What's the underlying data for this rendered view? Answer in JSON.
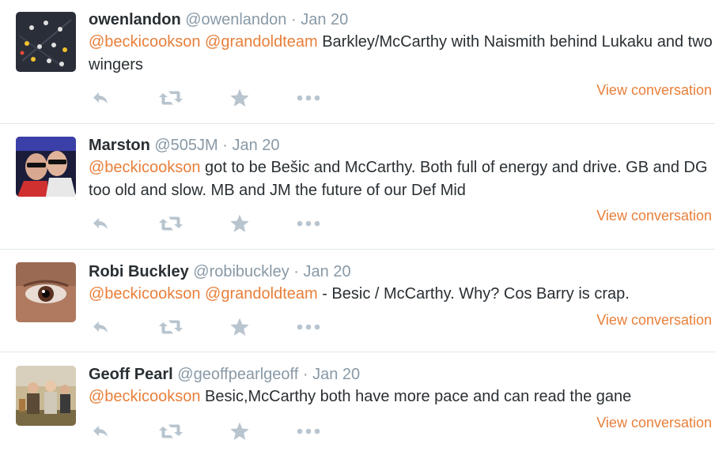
{
  "colors": {
    "accent": "#e87f3a",
    "muted": "#8899a6",
    "icon": "#b8c4ce",
    "text": "#292f33",
    "divider": "#e1e8ed"
  },
  "tweets": [
    {
      "name": "owenlandon",
      "handle": "@owenlandon",
      "separator": "·",
      "time": "Jan 20",
      "mentions": [
        "@beckicookson",
        "@grandoldteam"
      ],
      "text": " Barkley/McCarthy with Naismith behind Lukaku and two wingers",
      "view_conversation": "View conversation"
    },
    {
      "name": "Marston",
      "handle": "@505JM",
      "separator": "·",
      "time": "Jan 20",
      "mentions": [
        "@beckicookson"
      ],
      "text": " got to be Bešic and McCarthy. Both full of energy and drive. GB and DG too old and slow. MB and JM the future of our Def Mid",
      "view_conversation": "View conversation"
    },
    {
      "name": "Robi Buckley",
      "handle": "@robibuckley",
      "separator": "·",
      "time": "Jan 20",
      "mentions": [
        "@beckicookson",
        "@grandoldteam"
      ],
      "text": " - Besic / McCarthy.  Why? Cos Barry is crap.",
      "view_conversation": "View conversation"
    },
    {
      "name": "Geoff Pearl",
      "handle": "@geoffpearlgeoff",
      "separator": "·",
      "time": "Jan 20",
      "mentions": [
        "@beckicookson"
      ],
      "text": " Besic,McCarthy both have more pace and can read the gane",
      "view_conversation": "View conversation"
    }
  ],
  "action_icons": [
    "reply-icon",
    "retweet-icon",
    "favorite-icon",
    "more-icon"
  ]
}
